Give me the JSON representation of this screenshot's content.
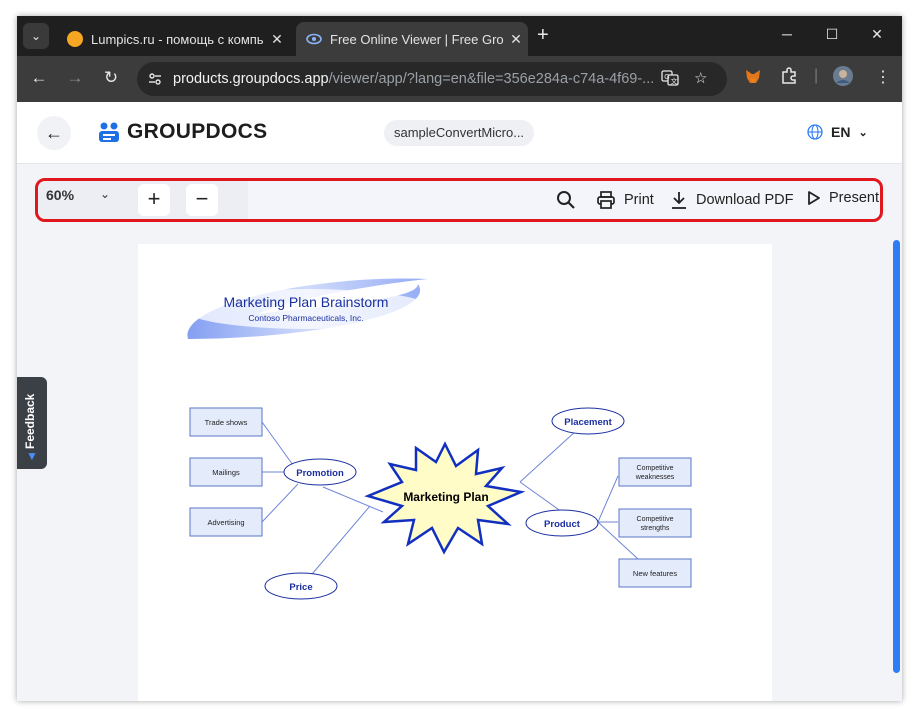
{
  "browser": {
    "tabs": [
      {
        "title": "Lumpics.ru - помощь с компь",
        "active": false
      },
      {
        "title": "Free Online Viewer | Free Group",
        "active": true
      }
    ],
    "url_host": "products.groupdocs.app",
    "url_path": "/viewer/app/?lang=en&file=356e284a-c74a-4f69-..."
  },
  "app": {
    "brand": "GROUPDOCS",
    "file_name": "sampleConvertMicro...",
    "language": "EN"
  },
  "viewer": {
    "zoom": "60%",
    "zoom_in": "+",
    "zoom_out": "−",
    "print_label": "Print",
    "download_label": "Download PDF",
    "present_label": "Present"
  },
  "feedback_label": "Feedback",
  "diagram": {
    "title": "Marketing Plan Brainstorm",
    "subtitle": "Contoso Pharmaceuticals, Inc.",
    "center": "Marketing Plan",
    "nodes": {
      "promotion": "Promotion",
      "placement": "Placement",
      "product": "Product",
      "price": "Price",
      "trade_shows": "Trade shows",
      "mailings": "Mailings",
      "advertising": "Advertising",
      "weak_1": "Competitive",
      "weak_2": "weaknesses",
      "strength_1": "Competitive",
      "strength_2": "strengths",
      "new_features": "New features"
    }
  },
  "colors": {
    "accent": "#2f7df6",
    "highlight": "#e0171d",
    "node_text": "#1a2fa0"
  }
}
